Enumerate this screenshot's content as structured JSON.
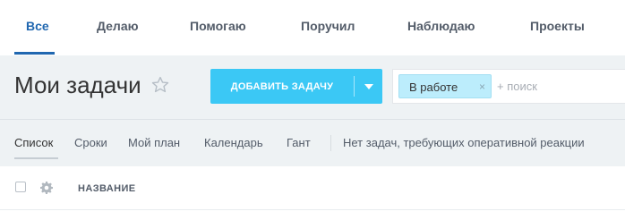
{
  "top_tabs": [
    {
      "label": "Все",
      "active": true
    },
    {
      "label": "Делаю"
    },
    {
      "label": "Помогаю"
    },
    {
      "label": "Поручил"
    },
    {
      "label": "Наблюдаю"
    },
    {
      "label": "Проекты"
    }
  ],
  "header": {
    "title": "Мои задачи",
    "add_button_label": "ДОБАВИТЬ ЗАДАЧУ"
  },
  "filter": {
    "chip_label": "В работе",
    "chip_remove": "×",
    "search_placeholder": "+ поиск"
  },
  "views": {
    "items": [
      {
        "label": "Список",
        "active": true
      },
      {
        "label": "Сроки"
      },
      {
        "label": "Мой план"
      },
      {
        "label": "Календарь"
      },
      {
        "label": "Гант"
      }
    ],
    "note": "Нет задач, требующих оперативной реакции"
  },
  "grid": {
    "column_name": "НАЗВАНИЕ"
  },
  "colors": {
    "accent_blue": "#2067b0",
    "button_blue": "#3bc8f5",
    "chip_bg": "#bcedfc",
    "page_bg": "#eef2f4"
  }
}
